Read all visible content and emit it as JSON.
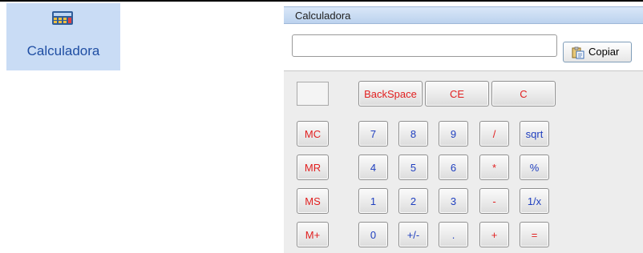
{
  "launcher": {
    "label": "Calculadora",
    "icon": "calculator-icon"
  },
  "window": {
    "title": "Calculadora"
  },
  "display": {
    "value": ""
  },
  "copy_button": {
    "label": "Copiar",
    "icon": "clipboard-copy-icon"
  },
  "keys": {
    "backspace": "BackSpace",
    "ce": "CE",
    "c": "C",
    "mc": "MC",
    "mr": "MR",
    "ms": "MS",
    "mplus": "M+",
    "k7": "7",
    "k8": "8",
    "k9": "9",
    "div": "/",
    "sqrt": "sqrt",
    "k4": "4",
    "k5": "5",
    "k6": "6",
    "mul": "*",
    "pct": "%",
    "k1": "1",
    "k2": "2",
    "k3": "3",
    "sub": "-",
    "inv": "1/x",
    "k0": "0",
    "sign": "+/-",
    "dot": ".",
    "add": "+",
    "eq": "="
  },
  "colors": {
    "function_key_text": "#e12020",
    "digit_key_text": "#1f3fbf",
    "title_bar": "#c6d9f1"
  }
}
